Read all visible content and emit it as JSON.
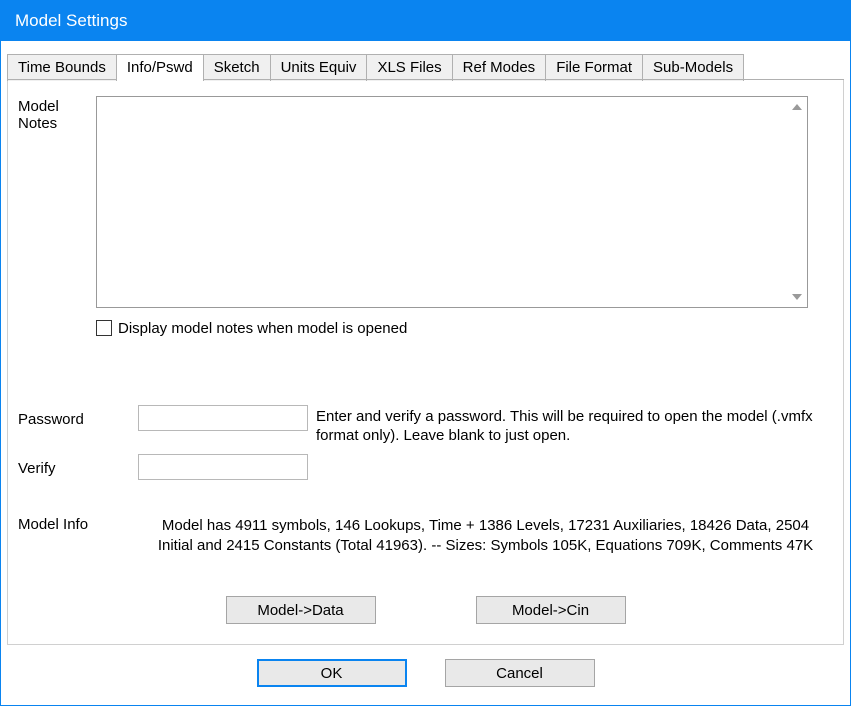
{
  "window": {
    "title": "Model Settings"
  },
  "tabs": [
    {
      "label": "Time Bounds",
      "active": false
    },
    {
      "label": "Info/Pswd",
      "active": true
    },
    {
      "label": "Sketch",
      "active": false
    },
    {
      "label": "Units Equiv",
      "active": false
    },
    {
      "label": "XLS Files",
      "active": false
    },
    {
      "label": "Ref Modes",
      "active": false
    },
    {
      "label": "File Format",
      "active": false
    },
    {
      "label": "Sub-Models",
      "active": false
    }
  ],
  "notes": {
    "label_line1": "Model",
    "label_line2": "Notes",
    "value": "",
    "display_checkbox_label": "Display model notes when model is opened",
    "display_checkbox_checked": false
  },
  "password": {
    "label": "Password",
    "verify_label": "Verify",
    "value": "",
    "verify_value": "",
    "help": "Enter and verify a password.  This will be required to open the model (.vmfx format only).  Leave blank to just open."
  },
  "model_info": {
    "label": "Model Info",
    "text": "Model has 4911 symbols, 146 Lookups, Time + 1386 Levels, 17231 Auxiliaries, 18426 Data, 2504 Initial and 2415 Constants (Total 41963). -- Sizes: Symbols 105K, Equations 709K, Comments 47K"
  },
  "buttons": {
    "model_data": "Model->Data",
    "model_cin": "Model->Cin",
    "ok": "OK",
    "cancel": "Cancel"
  }
}
